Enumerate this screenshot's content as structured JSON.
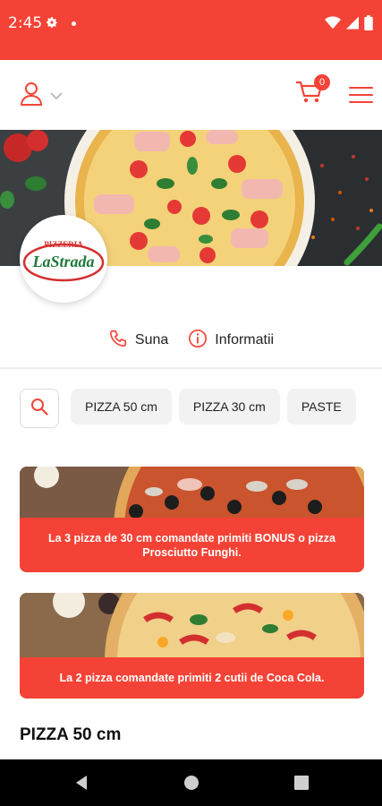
{
  "status_bar": {
    "time": "2:45",
    "icons": [
      "settings-icon",
      "notification-dot",
      "wifi-icon",
      "signal-icon",
      "battery-icon"
    ]
  },
  "header": {
    "cart_count": "0",
    "icons": [
      "user-icon",
      "chevron-down-icon",
      "cart-icon",
      "menu-icon"
    ]
  },
  "restaurant": {
    "logo_top": "PIZZERIA",
    "logo_name": "LaStrada"
  },
  "actions": {
    "call_label": "Suna",
    "info_label": "Informatii"
  },
  "categories": [
    "PIZZA 50 cm",
    "PIZZA 30 cm",
    "PASTE"
  ],
  "promos": [
    {
      "text": "La 3 pizza de 30 cm comandate primiti BONUS o pizza Prosciutto Funghi."
    },
    {
      "text": "La 2 pizza comandate primiti 2 cutii de Coca Cola."
    }
  ],
  "section": {
    "title": "PIZZA 50 cm"
  },
  "colors": {
    "accent": "#f44336",
    "logo_green": "#1f7a3a",
    "logo_red": "#d32f2f"
  }
}
